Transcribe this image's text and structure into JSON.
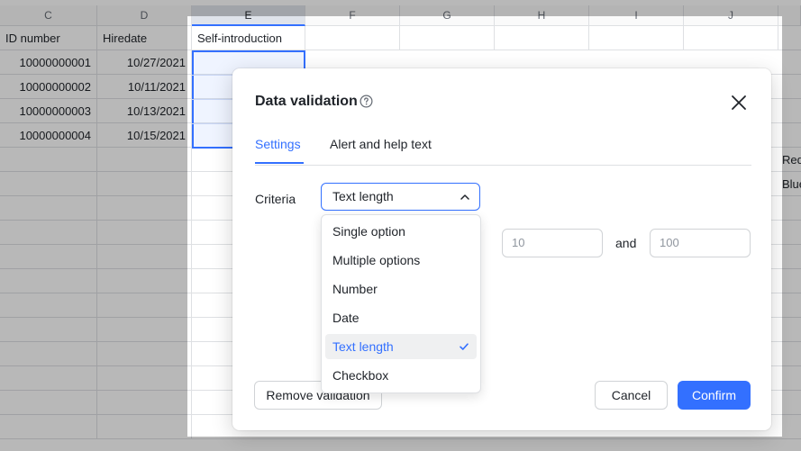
{
  "sheet": {
    "columns": [
      "C",
      "D",
      "E",
      "F",
      "G",
      "H",
      "I",
      "J"
    ],
    "active_column": "E",
    "header_row": [
      "ID number",
      "Hiredate",
      "Self-introduction"
    ],
    "rows": [
      {
        "id": "10000000001",
        "hiredate": "10/27/2021"
      },
      {
        "id": "10000000002",
        "hiredate": "10/11/2021"
      },
      {
        "id": "10000000003",
        "hiredate": "10/13/2021"
      },
      {
        "id": "10000000004",
        "hiredate": "10/15/2021"
      }
    ],
    "edge_values": [
      "Red",
      "Blue"
    ]
  },
  "dialog": {
    "title": "Data validation",
    "tabs": [
      {
        "label": "Settings",
        "active": true
      },
      {
        "label": "Alert and help text",
        "active": false
      }
    ],
    "criteria_label": "Criteria",
    "criteria_value": "Text length",
    "range": {
      "min_placeholder": "10",
      "joiner": "and",
      "max_placeholder": "100"
    },
    "remove_label": "Remove validation",
    "cancel_label": "Cancel",
    "confirm_label": "Confirm"
  },
  "dropdown": {
    "options": [
      "Single option",
      "Multiple options",
      "Number",
      "Date",
      "Text length",
      "Checkbox"
    ],
    "selected_option": "Text length"
  },
  "icons": {
    "help": "help-circle-icon",
    "close": "close-icon",
    "chevron": "chevron-up-icon",
    "check": "check-icon"
  },
  "colors": {
    "accent": "#3370ff",
    "text": "#1f2329",
    "border": "#dee0e3"
  }
}
